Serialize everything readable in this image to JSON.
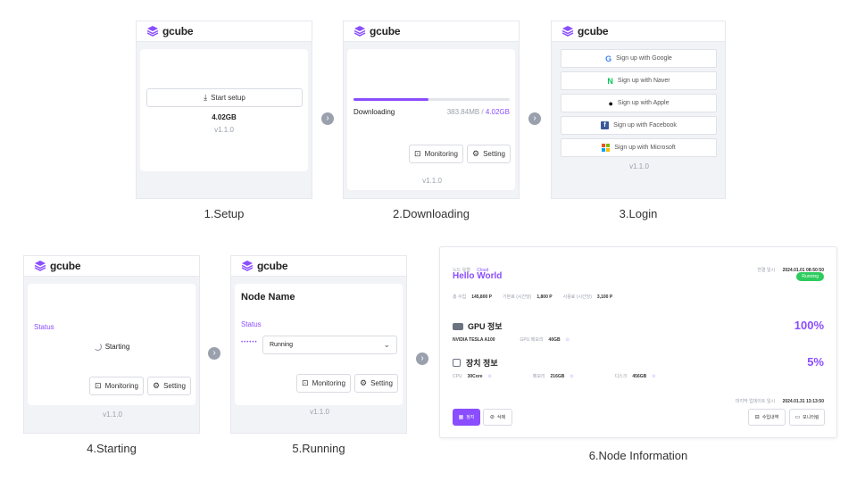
{
  "brand": {
    "name": "gcube"
  },
  "captions": {
    "setup": "1.Setup",
    "downloading": "2.Downloading",
    "login": "3.Login",
    "starting": "4.Starting",
    "running": "5.Running",
    "node_info": "6.Node Information"
  },
  "version": "v1.1.0",
  "setup": {
    "start_label": "Start setup",
    "size": "4.02GB"
  },
  "downloading": {
    "label": "Downloading",
    "done": "383.84MB",
    "sep": " / ",
    "total": "4.02GB",
    "progress": 0.48
  },
  "buttons": {
    "monitoring": "Monitoring",
    "setting": "Setting"
  },
  "login": {
    "options": [
      {
        "label": "Sign up with Google",
        "icon": "google-icon"
      },
      {
        "label": "Sign up with Naver",
        "icon": "naver-icon"
      },
      {
        "label": "Sign up with Apple",
        "icon": "apple-icon"
      },
      {
        "label": "Sign up with Facebook",
        "icon": "facebook-icon"
      },
      {
        "label": "Sign up with Microsoft",
        "icon": "microsoft-icon"
      }
    ]
  },
  "starting": {
    "status_label": "Status",
    "state": "Starting"
  },
  "running": {
    "node_name": "Node Name",
    "status_label": "Status",
    "dots": "••••••",
    "state": "Running"
  },
  "node_info": {
    "node_type_label": "노드 유형",
    "node_type": "Cloud",
    "conn_label": "연결 일시",
    "conn_time": "2024.01.01 08:50:50",
    "name": "Hello World",
    "status": "Running",
    "total_label": "총 수입",
    "total": "145,800 P",
    "base_label": "기본료 (시간당)",
    "base": "1,800 P",
    "usage_label": "사용료 (시간당)",
    "usage": "3,100 P",
    "gpu_title": "GPU 정보",
    "gpu_percent": "100%",
    "gpu_model": "NVIDIA TESLA A100",
    "gpu_mem_label": "GPU 메모리",
    "gpu_mem": "40GB",
    "dev_title": "장치 정보",
    "dev_percent": "5%",
    "cpu_label": "CPU",
    "cpu": "30Core",
    "mem_label": "메모리",
    "mem": "216GB",
    "disk_label": "디스크",
    "disk": "456GB",
    "updated_label": "마지막 업데이트 일시",
    "updated": "2024.01.31 13:13:50",
    "stop_label": "정지",
    "delete_label": "삭제",
    "earn_label": "수입내역",
    "monitor_label": "모니터링"
  }
}
